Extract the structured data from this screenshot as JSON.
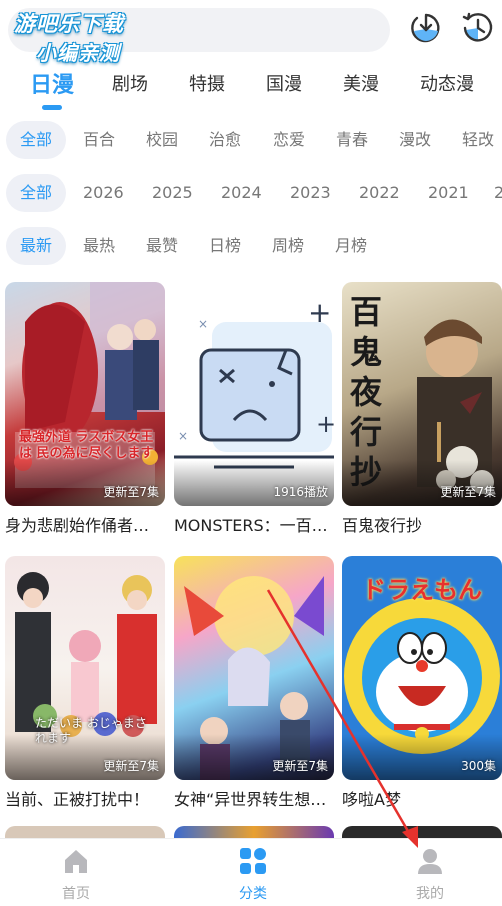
{
  "watermark": {
    "line1": "游吧乐下载",
    "line2": "小编亲测"
  },
  "header": {
    "download_icon": "download-icon",
    "history_icon": "history-clock-icon"
  },
  "category_tabs": [
    "日漫",
    "剧场",
    "特摄",
    "国漫",
    "美漫",
    "动态漫"
  ],
  "active_category": "日漫",
  "filters": {
    "genre": [
      "全部",
      "百合",
      "校园",
      "治愈",
      "恋爱",
      "青春",
      "漫改",
      "轻改"
    ],
    "year": [
      "全部",
      "2026",
      "2025",
      "2024",
      "2023",
      "2022",
      "2021",
      "2"
    ],
    "sort": [
      "最新",
      "最热",
      "最赞",
      "日榜",
      "周榜",
      "月榜"
    ]
  },
  "cards": [
    {
      "title": "身为悲剧始作俑者…",
      "badge": "更新至7集",
      "cover_text": "最強外道 ラスボス女王は 民の為に尽くします"
    },
    {
      "title": "MONSTERS：一百…",
      "badge": "1916播放",
      "cover_text": ""
    },
    {
      "title": "百鬼夜行抄",
      "badge": "更新至7集",
      "cover_text": "百鬼夜行抄"
    },
    {
      "title": "当前、正被打扰中！",
      "badge": "更新至7集",
      "cover_text": "ただいま おじゃまされます"
    },
    {
      "title": "女神“异世界转生想…",
      "badge": "更新至7集",
      "cover_text": ""
    },
    {
      "title": "哆啦A梦",
      "badge": "300集",
      "cover_text": "ドラえもん"
    }
  ],
  "bottom_nav": [
    {
      "label": "首页",
      "icon": "home-icon"
    },
    {
      "label": "分类",
      "icon": "category-grid-icon"
    },
    {
      "label": "我的",
      "icon": "user-icon"
    }
  ],
  "active_nav": "分类",
  "colors": {
    "accent": "#2b9af3",
    "annotation_arrow": "#e5322d",
    "chip_bg": "#eef0f6"
  }
}
